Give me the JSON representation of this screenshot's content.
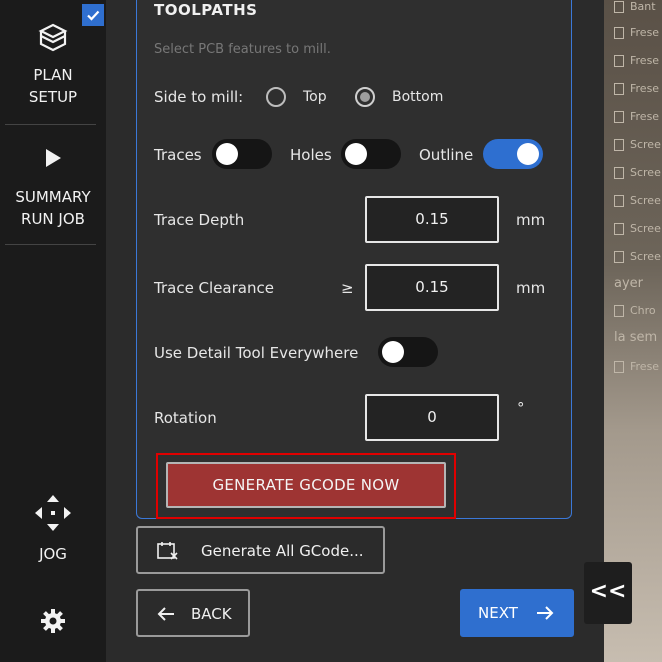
{
  "sidebar": {
    "plan_setup": {
      "line1": "PLAN",
      "line2": "SETUP"
    },
    "summary": {
      "line1": "SUMMARY",
      "line2": "RUN JOB"
    },
    "jog": "JOG"
  },
  "toolpaths": {
    "title": "TOOLPATHS",
    "subtitle": "Select PCB features to mill.",
    "side_label": "Side to mill:",
    "side_options": [
      {
        "label": "Top",
        "selected": false
      },
      {
        "label": "Bottom",
        "selected": true
      }
    ],
    "traces": {
      "label": "Traces",
      "on": false
    },
    "holes": {
      "label": "Holes",
      "on": false
    },
    "outline": {
      "label": "Outline",
      "on": true
    },
    "trace_depth": {
      "label": "Trace Depth",
      "value": "0.15",
      "unit": "mm"
    },
    "trace_clearance": {
      "label": "Trace Clearance",
      "symbol": "≥",
      "value": "0.15",
      "unit": "mm"
    },
    "detail_tool": {
      "label": "Use Detail Tool Everywhere",
      "on": false
    },
    "rotation": {
      "label": "Rotation",
      "value": "0",
      "unit": "°"
    },
    "generate_now": "GENERATE GCODE NOW"
  },
  "actions": {
    "generate_all": "Generate All GCode...",
    "back": "BACK",
    "next": "NEXT"
  },
  "background_list": [
    "Bant",
    "Frese",
    "Frese",
    "Frese",
    "Frese",
    "Scree",
    "Scree",
    "Scree",
    "Scree",
    "Scree",
    "ayer",
    "Chro",
    "la sem",
    "Frese"
  ],
  "collapse_label": "<<",
  "colors": {
    "accent": "#2f6fcf",
    "generate": "#9e3433",
    "highlight": "#e00000"
  }
}
